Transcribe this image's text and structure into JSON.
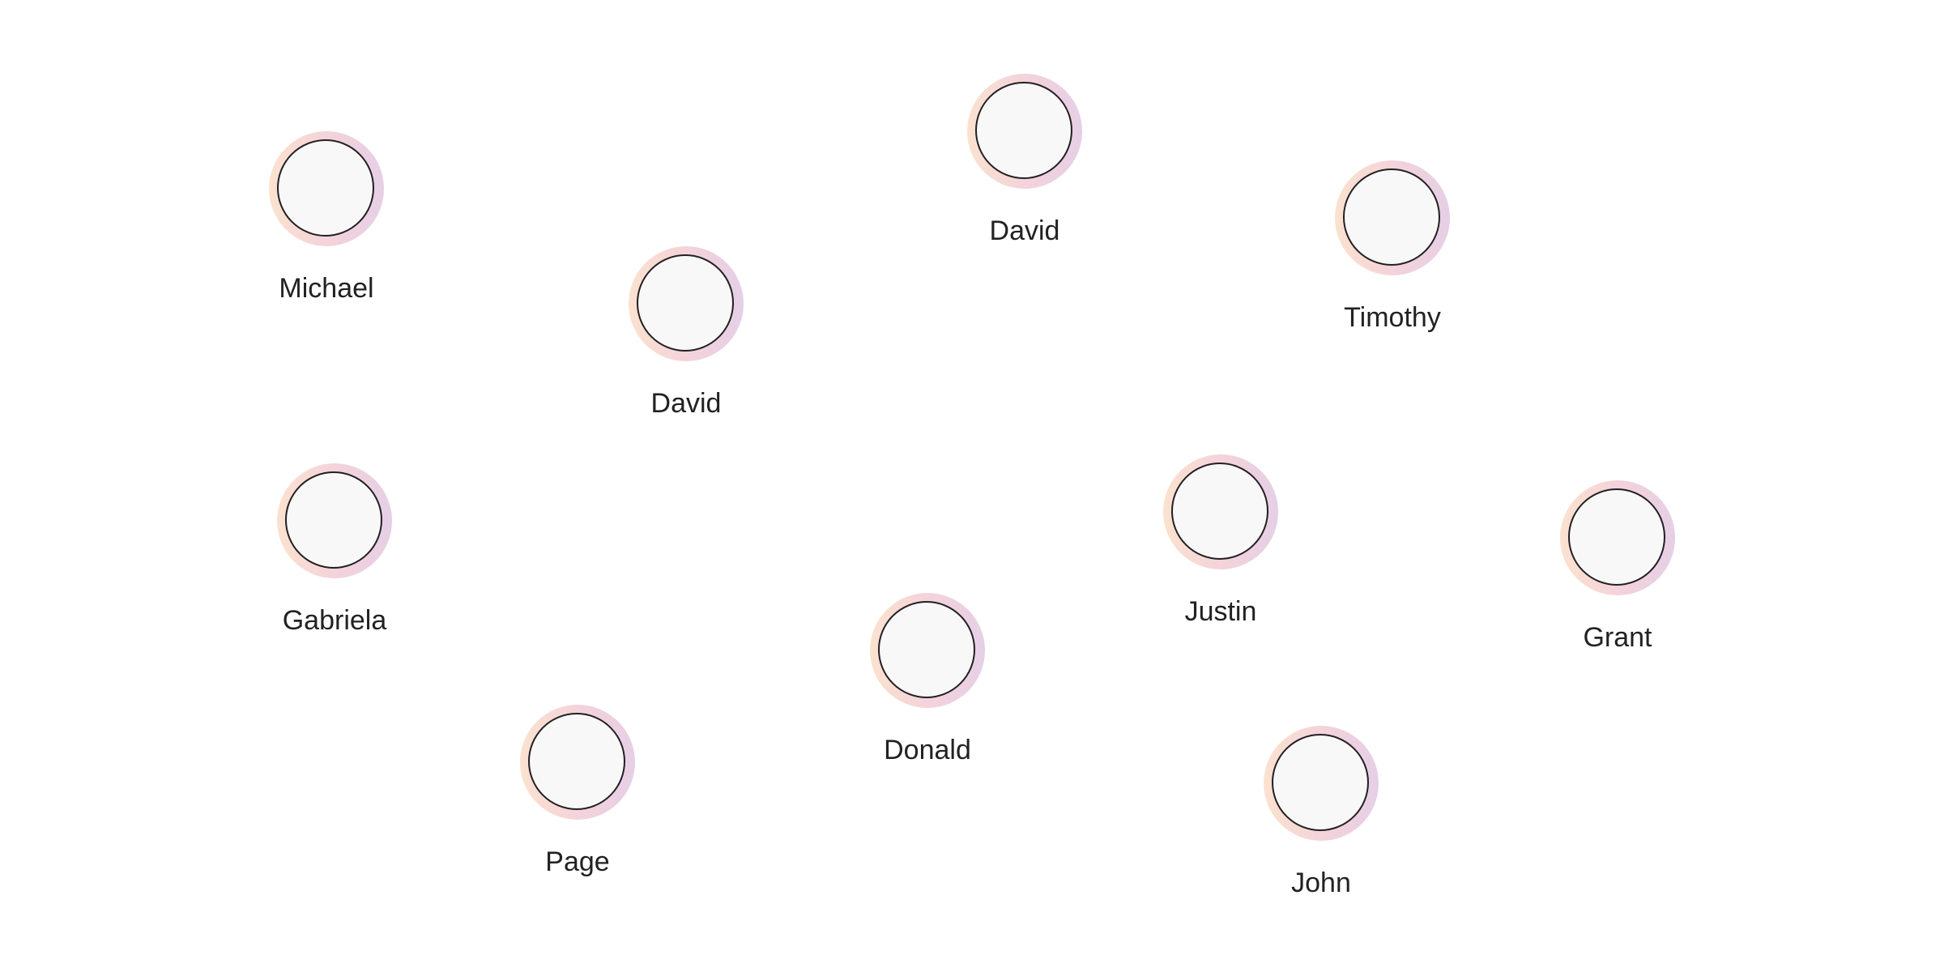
{
  "diagram": {
    "type": "people-nodes",
    "colors": {
      "background": "#ffffff",
      "ring_left": "#fbe2cf",
      "ring_mid": "#f4d3da",
      "ring_right": "#e6cfe6",
      "avatar_fill": "#f8f8f8",
      "avatar_stroke": "#231f22",
      "label": "#222222"
    },
    "nodes": [
      {
        "id": "michael",
        "label": "Michael"
      },
      {
        "id": "david-1",
        "label": "David"
      },
      {
        "id": "david-2",
        "label": "David"
      },
      {
        "id": "timothy",
        "label": "Timothy"
      },
      {
        "id": "gabriela",
        "label": "Gabriela"
      },
      {
        "id": "justin",
        "label": "Justin"
      },
      {
        "id": "grant",
        "label": "Grant"
      },
      {
        "id": "donald",
        "label": "Donald"
      },
      {
        "id": "page",
        "label": "Page"
      },
      {
        "id": "john",
        "label": "John"
      }
    ]
  }
}
